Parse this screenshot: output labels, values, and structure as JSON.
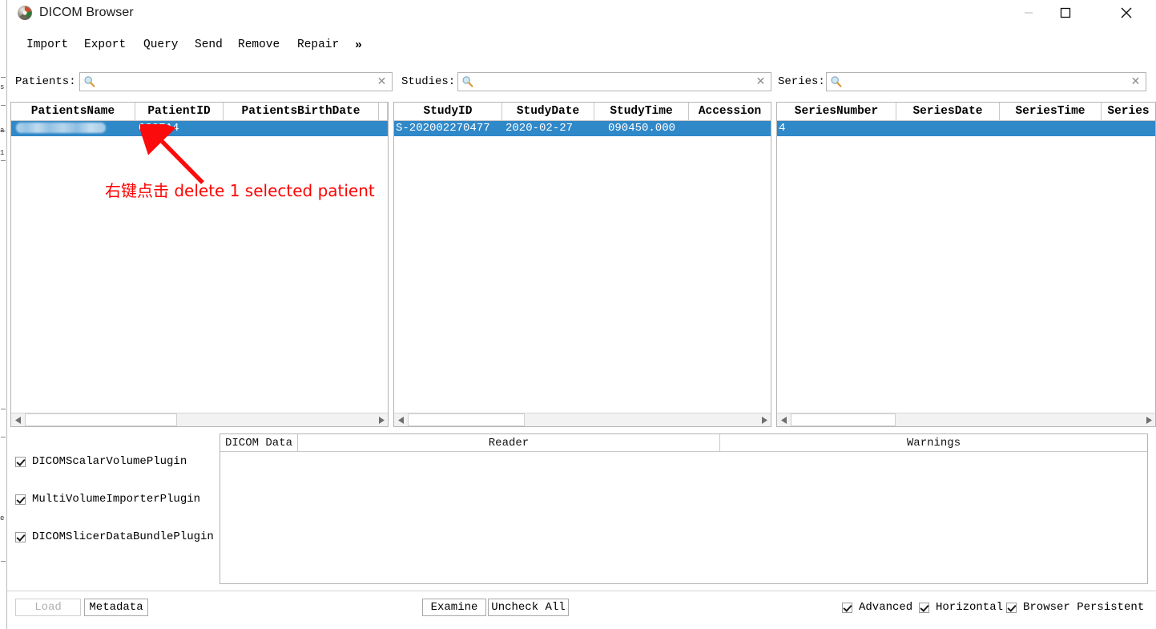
{
  "window": {
    "title": "DICOM Browser",
    "icon": "dicom-browser-app-icon",
    "minimize_label": "—",
    "maximize_label": "□",
    "close_label": "✕"
  },
  "toolbar": {
    "items": [
      {
        "label": "Import",
        "name": "import"
      },
      {
        "label": "Export",
        "name": "export"
      },
      {
        "label": "Query",
        "name": "query"
      },
      {
        "label": "Send",
        "name": "send"
      },
      {
        "label": "Remove",
        "name": "remove"
      },
      {
        "label": "Repair",
        "name": "repair"
      }
    ],
    "overflow_label": "»"
  },
  "search": {
    "patients": {
      "label": "Patients:",
      "value": "",
      "placeholder": "",
      "clear": "✕",
      "icon": "magnifier-icon"
    },
    "studies": {
      "label": "Studies:",
      "value": "",
      "placeholder": "",
      "clear": "✕",
      "icon": "magnifier-icon"
    },
    "series": {
      "label": "Series:",
      "value": "",
      "placeholder": "",
      "clear": "✕",
      "icon": "magnifier-icon"
    }
  },
  "patients_table": {
    "columns": [
      "PatientsName",
      "PatientID",
      "PatientsBirthDate"
    ],
    "rows": [
      {
        "PatientsName": "",
        "PatientsName_redacted": true,
        "PatientID": "0227A4",
        "PatientsBirthDate": "",
        "selected": true
      }
    ]
  },
  "studies_table": {
    "columns": [
      "StudyID",
      "StudyDate",
      "StudyTime",
      "AccessionNumber"
    ],
    "columns_display": [
      "StudyID",
      "StudyDate",
      "StudyTime",
      "Accession"
    ],
    "rows": [
      {
        "StudyID": "S-202002270477",
        "StudyDate": "2020-02-27",
        "StudyTime": "090450.000",
        "AccessionNumber": "",
        "selected": true
      }
    ]
  },
  "series_table": {
    "columns": [
      "SeriesNumber",
      "SeriesDate",
      "SeriesTime",
      "SeriesDescription"
    ],
    "columns_display": [
      "SeriesNumber",
      "SeriesDate",
      "SeriesTime",
      "Series"
    ],
    "rows": [
      {
        "SeriesNumber": "4",
        "SeriesDate": "",
        "SeriesTime": "",
        "SeriesDescription": "",
        "selected": true
      }
    ]
  },
  "plugins": [
    {
      "label": "DICOMScalarVolumePlugin",
      "checked": true,
      "name": "dicom-scalar-volume-plugin"
    },
    {
      "label": "MultiVolumeImporterPlugin",
      "checked": true,
      "name": "multi-volume-importer-plugin"
    },
    {
      "label": "DICOMSlicerDataBundlePlugin",
      "checked": true,
      "name": "dicom-slicer-data-bundle-plugin"
    }
  ],
  "data_table": {
    "columns": [
      "DICOM Data",
      "Reader",
      "Warnings"
    ],
    "rows": []
  },
  "bottom": {
    "load_label": "Load",
    "load_disabled": true,
    "metadata_label": "Metadata",
    "examine_label": "Examine",
    "uncheck_all_label": "Uncheck All",
    "checkboxes": [
      {
        "label": "Advanced",
        "checked": true,
        "name": "advanced"
      },
      {
        "label": "Horizontal",
        "checked": true,
        "name": "horizontal"
      },
      {
        "label": "Browser Persistent",
        "checked": true,
        "name": "browser-persistent"
      }
    ]
  },
  "annotation": {
    "text": "右键点击 delete 1 selected patient",
    "color": "#ff0000",
    "arrow": "red-arrow-pointing-to-selected-patient-row"
  },
  "colors": {
    "selection_blue": "#2f88c8",
    "annotation_red": "#ff0000",
    "panel_border": "#b4b4b4",
    "scrollbar_track": "#f2f2f2"
  }
}
